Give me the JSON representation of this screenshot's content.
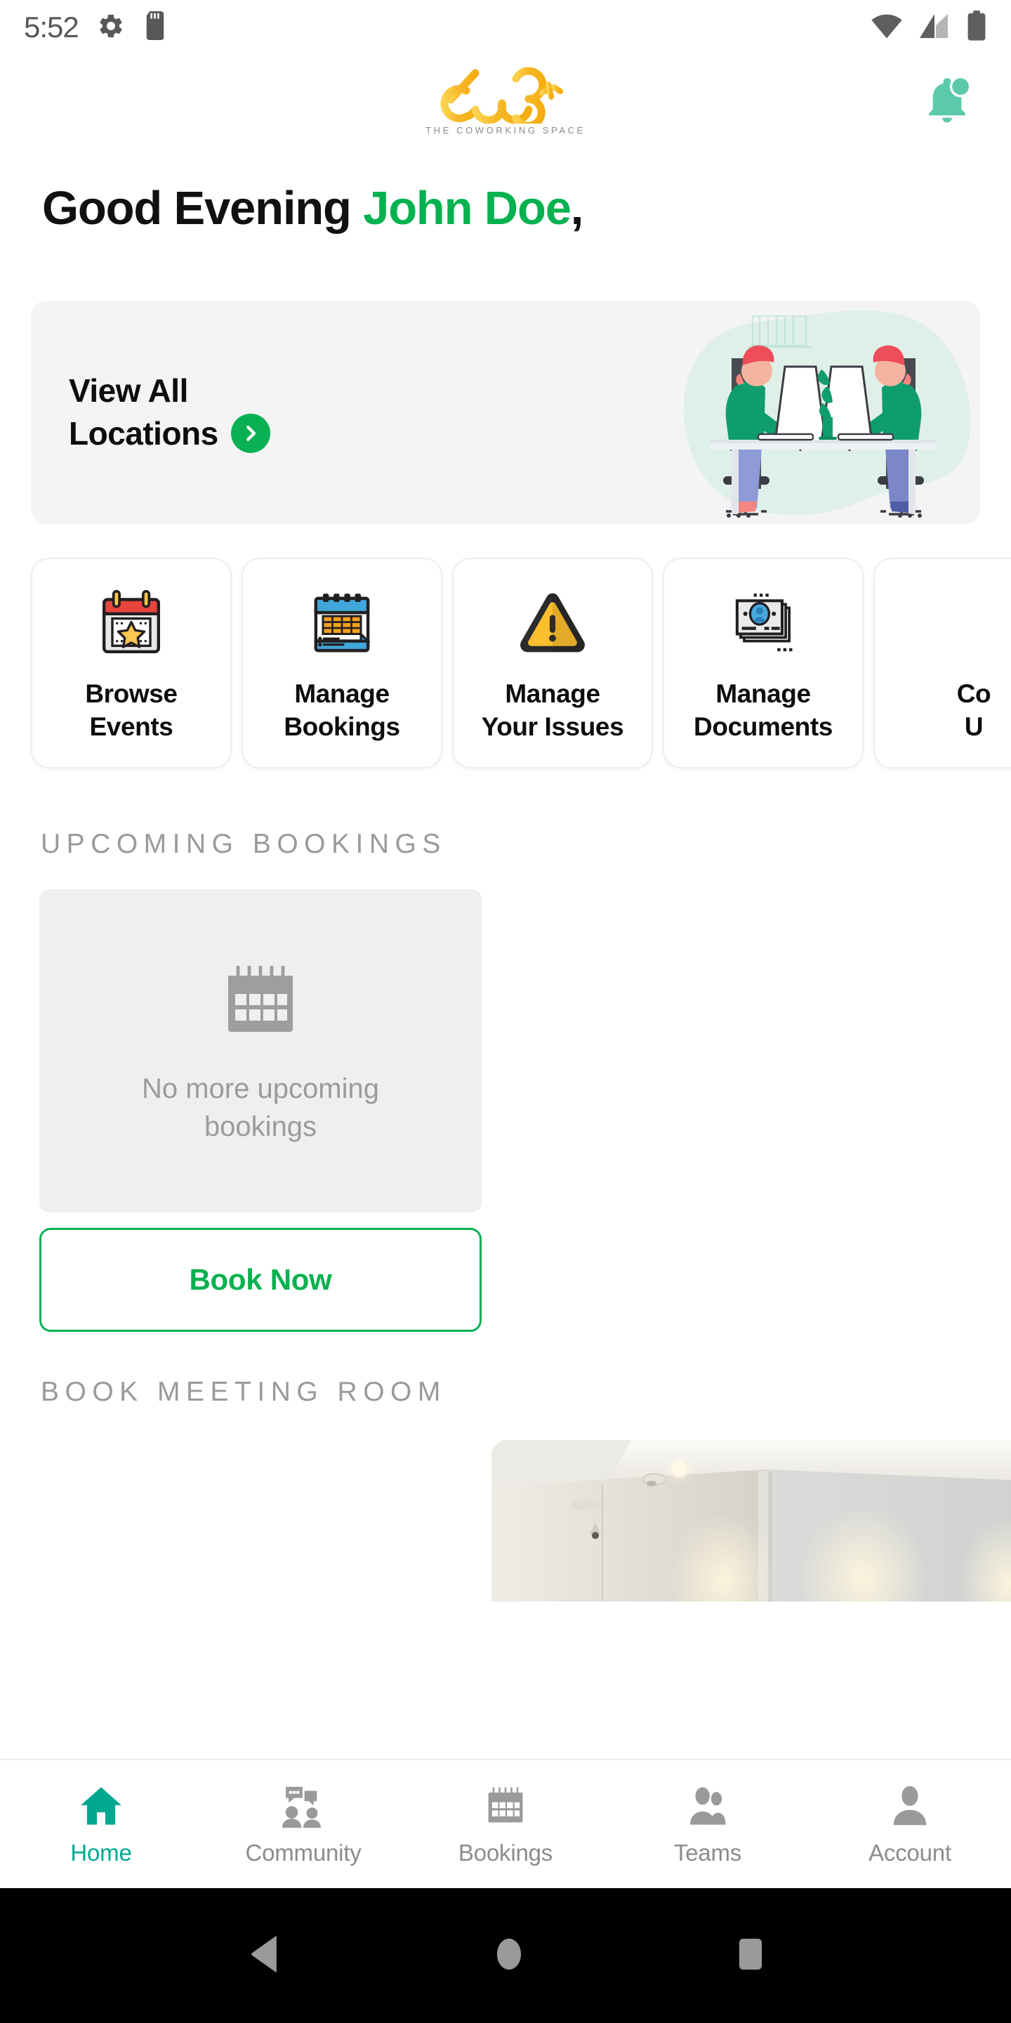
{
  "status_bar": {
    "time": "5:52",
    "left_icons": [
      "settings-gear-icon",
      "sd-card-icon"
    ],
    "right_icons": [
      "wifi-icon",
      "cellular-signal-icon",
      "battery-icon"
    ]
  },
  "header": {
    "logo_text": "603",
    "logo_tagline": "THE COWORKING SPACE",
    "notification_icon": "bell-icon",
    "has_notification_badge": true
  },
  "greeting": {
    "salutation": "Good Evening ",
    "user_name": "John Doe",
    "comma": ","
  },
  "locations_banner": {
    "line1": "View All",
    "line2": "Locations",
    "chevron_icon": "chevron-right-icon",
    "illustration": "coworking-desks-illustration",
    "background_color": "#f4f4f4"
  },
  "quick_actions": [
    {
      "label": "Browse\nEvents",
      "icon": "calendar-star-icon"
    },
    {
      "label": "Manage\nBookings",
      "icon": "calendar-grid-icon"
    },
    {
      "label": "Manage\nYour Issues",
      "icon": "warning-triangle-icon"
    },
    {
      "label": "Manage\nDocuments",
      "icon": "id-cards-icon"
    },
    {
      "label": "Co\nU",
      "icon": "contact-icon"
    }
  ],
  "upcoming_bookings": {
    "section_title": "UPCOMING BOOKINGS",
    "empty_icon": "calendar-icon",
    "empty_message": "No more upcoming bookings",
    "cta_label": "Book Now"
  },
  "book_meeting_room": {
    "section_title": "BOOK MEETING ROOM",
    "cards": [
      {
        "image": "meeting-room-interior-photo"
      }
    ]
  },
  "bottom_nav": {
    "items": [
      {
        "label": "Home",
        "icon": "home-icon",
        "active": true
      },
      {
        "label": "Community",
        "icon": "community-icon",
        "active": false
      },
      {
        "label": "Bookings",
        "icon": "calendar-icon",
        "active": false
      },
      {
        "label": "Teams",
        "icon": "people-icon",
        "active": false
      },
      {
        "label": "Account",
        "icon": "person-icon",
        "active": false
      }
    ],
    "active_color": "#00a88f",
    "inactive_color": "#8c8c8c"
  },
  "system_nav": {
    "back_icon": "triangle-back-icon",
    "home_icon": "circle-home-icon",
    "recents_icon": "square-recents-icon"
  },
  "colors": {
    "brand_green": "#06b24f",
    "accent_green": "#0ab152",
    "nav_teal": "#00a88f",
    "logo_gold": "#f5b81c",
    "bell_mint": "#5cc9ab"
  }
}
